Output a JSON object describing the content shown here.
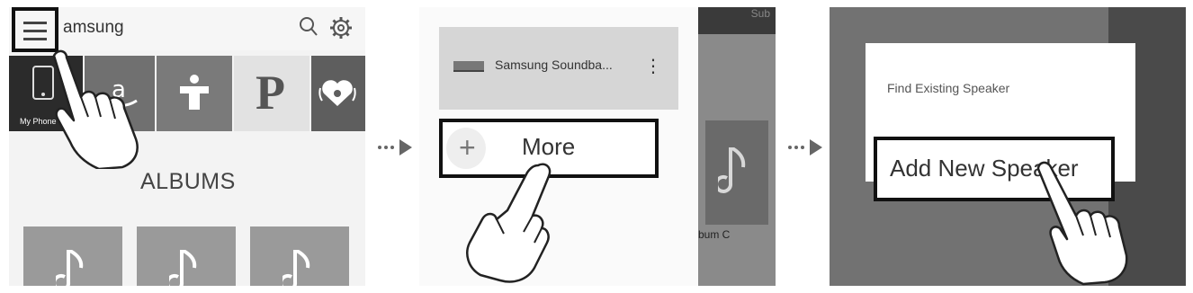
{
  "panel1": {
    "title": "amsung",
    "icons": [
      "menu-icon",
      "search-icon",
      "gear-icon"
    ],
    "sources": [
      {
        "name": "my-phone",
        "icon": "phone-icon",
        "label": "My Phone"
      },
      {
        "name": "amazon",
        "icon": "amazon-logo-icon",
        "label": ""
      },
      {
        "name": "tunein",
        "icon": "tunein-logo-icon",
        "label": ""
      },
      {
        "name": "pandora",
        "icon": "pandora-logo-icon",
        "label": "P"
      },
      {
        "name": "iheart",
        "icon": "iheart-logo-icon",
        "label": ""
      }
    ],
    "section_title": "ALBUMS"
  },
  "panel2": {
    "device_name": "Samsung Soundba...",
    "more_label": "More",
    "background_top_text": "Sub",
    "background_album_label": "bum C"
  },
  "panel3": {
    "find_label": "Find Existing Speaker",
    "add_label": "Add New Speaker"
  },
  "colors": {
    "highlight_border": "#111111",
    "dark_tile": "#2b2b2b"
  }
}
